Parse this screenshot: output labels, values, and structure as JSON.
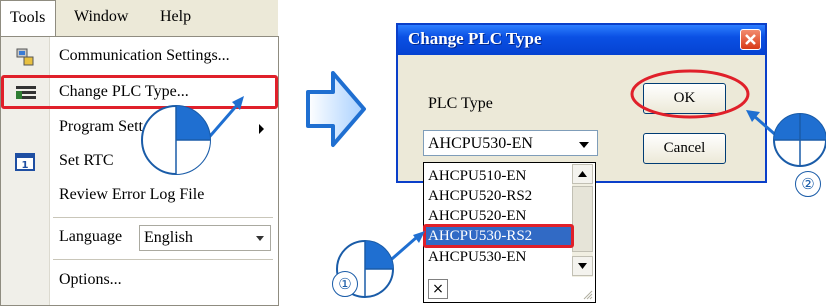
{
  "menubar": {
    "items": [
      "Tools",
      "Window",
      "Help"
    ]
  },
  "tools_menu": {
    "items": [
      {
        "label": "Communication Settings...",
        "icon": "communication-icon"
      },
      {
        "label": "Change PLC Type...",
        "icon": "plc-type-icon"
      },
      {
        "label": "Program Sett",
        "has_submenu": true
      },
      {
        "label": "Set RTC",
        "icon": "calendar-icon"
      },
      {
        "label": "Review Error Log File"
      },
      {
        "label": "Language",
        "value": "English"
      },
      {
        "label": "Options..."
      }
    ]
  },
  "dialog": {
    "title": "Change PLC Type",
    "plc_type_label": "PLC Type",
    "ok_label": "OK",
    "cancel_label": "Cancel",
    "selected_value": "AHCPU530-EN",
    "options": [
      "AHCPU510-EN",
      "AHCPU520-RS2",
      "AHCPU520-EN",
      "AHCPU530-RS2",
      "AHCPU530-EN"
    ],
    "highlighted_option": "AHCPU530-RS2",
    "clear_symbol": "×"
  },
  "steps": {
    "one": "①",
    "two": "②"
  },
  "colors": {
    "highlight": "#e0202a",
    "pointer": "#1f6fd1",
    "selection": "#316ac5",
    "titlebar": "#0a50e4"
  }
}
